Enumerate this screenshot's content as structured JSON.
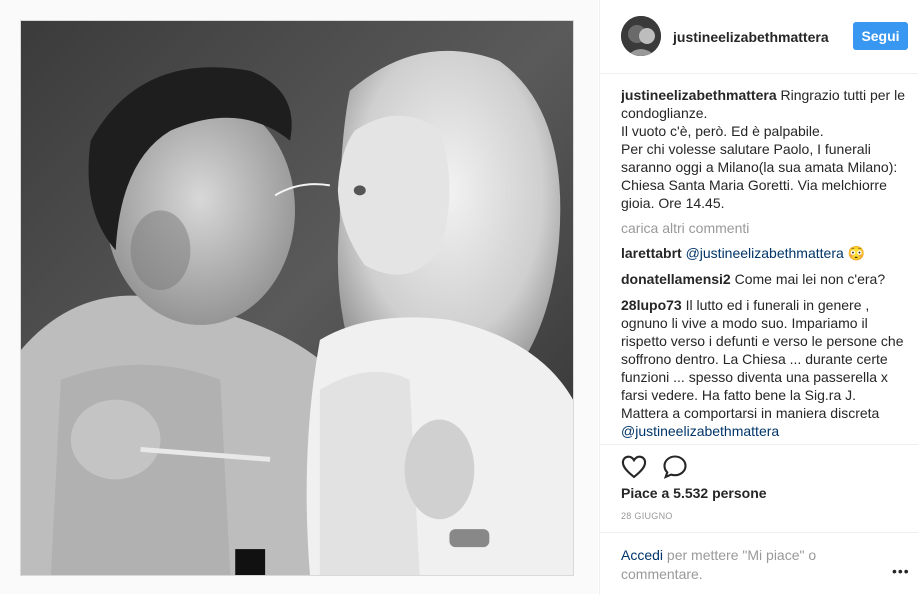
{
  "post": {
    "image_alt": "",
    "username": "justineelizabethmattera",
    "follow_label": "Segui"
  },
  "caption": {
    "username": "justineelizabethmattera",
    "lines": [
      "Ringrazio tutti per le condoglianze.",
      "Il vuoto c'è, però. Ed è palpabile.",
      "Per chi volesse salutare Paolo, I funerali saranno oggi a Milano(la sua amata Milano): Chiesa Santa Maria Goretti. Via melchiorre gioia. Ore 14.45."
    ]
  },
  "load_more": "carica altri commenti",
  "comments": [
    {
      "username": "larettabrt",
      "mention": "@justineelizabethmattera",
      "text": " 😳"
    },
    {
      "username": "donatellamensi2",
      "text": "Come mai lei non c'era?"
    },
    {
      "username": "28lupo73",
      "text": "Il lutto ed i funerali in genere , ognuno li vive a modo suo. Impariamo il rispetto verso i defunti e verso le persone che soffrono dentro. La Chiesa ... durante certe funzioni ... spesso diventa una passerella x farsi vedere. Ha fatto bene la Sig.ra J. Mattera a comportarsi in maniera discreta",
      "mention": "@justineelizabethmattera"
    }
  ],
  "actions": {
    "like_icon": "heart-icon",
    "comment_icon": "comment-bubble-icon",
    "likes": "Piace a 5.532 persone",
    "date": "28 GIUGNO"
  },
  "login": {
    "link": "Accedi",
    "text": " per mettere \"Mi piace\" o commentare.",
    "more": "•••"
  },
  "colors": {
    "accent": "#3897f0",
    "link": "#003569",
    "muted": "#999999",
    "text": "#262626"
  }
}
